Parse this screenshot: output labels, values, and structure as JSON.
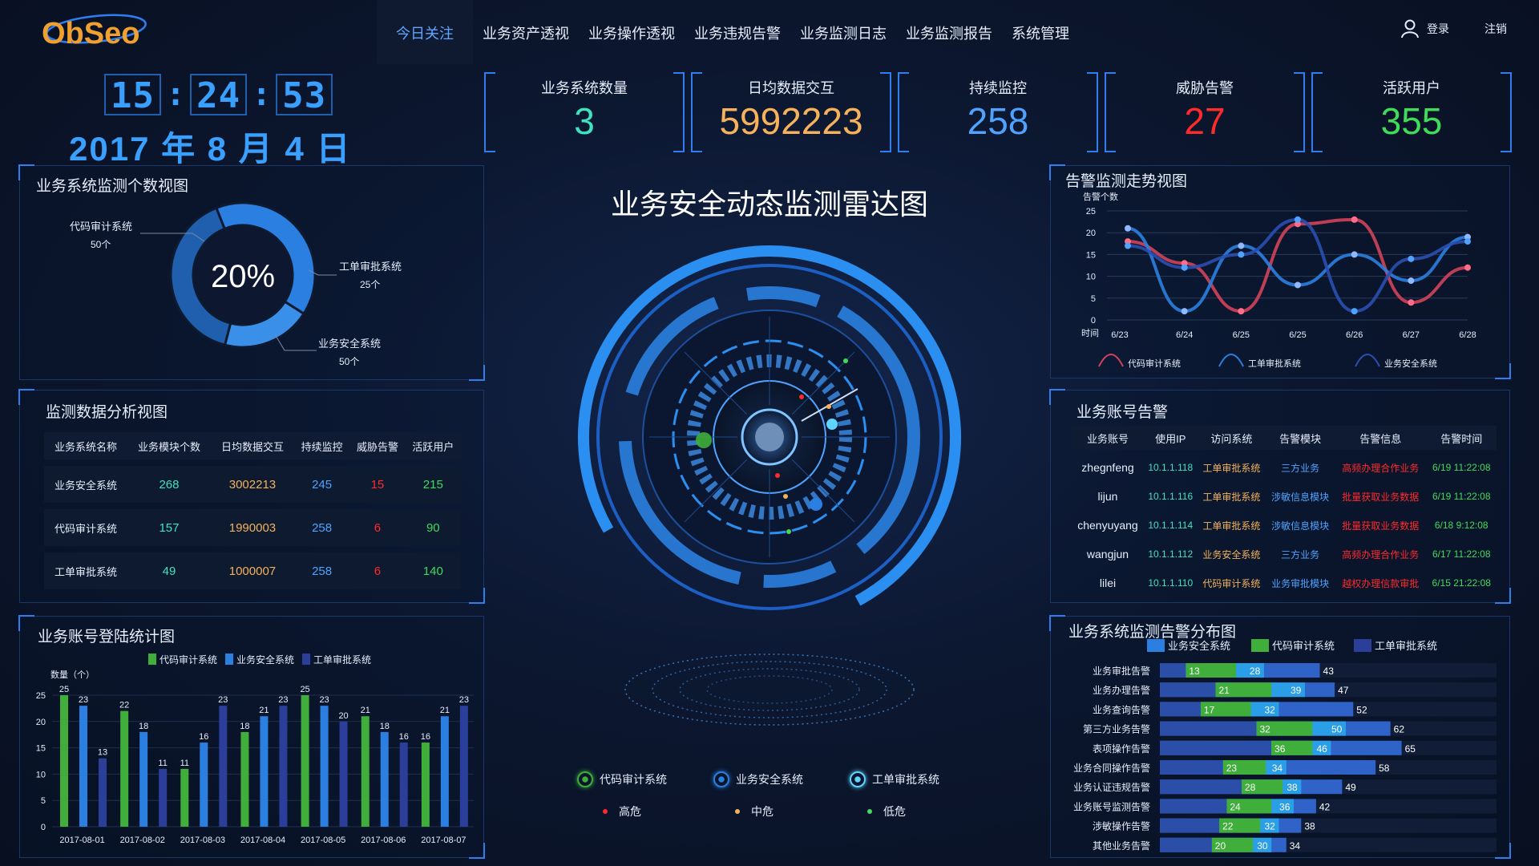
{
  "header": {
    "logo_text": "ObSeo",
    "nav": [
      {
        "label": "今日关注",
        "active": true
      },
      {
        "label": "业务资产透视",
        "active": false
      },
      {
        "label": "业务操作透视",
        "active": false
      },
      {
        "label": "业务违规告警",
        "active": false
      },
      {
        "label": "业务监测日志",
        "active": false
      },
      {
        "label": "业务监测报告",
        "active": false
      },
      {
        "label": "系统管理",
        "active": false
      }
    ],
    "login": "登录",
    "logout": "注销",
    "user_icon": "user-icon"
  },
  "clock": {
    "h": "15",
    "m": "24",
    "s": "53"
  },
  "date": "2017 年  8 月 4 日",
  "kpis": [
    {
      "label": "业务系统数量",
      "value": "3",
      "color": "#3fe3c0"
    },
    {
      "label": "日均数据交互",
      "value": "5992223",
      "color": "#f5b25a"
    },
    {
      "label": "持续监控",
      "value": "258",
      "color": "#4fa3ff"
    },
    {
      "label": "威胁告警",
      "value": "27",
      "color": "#ff2a2a"
    },
    {
      "label": "活跃用户",
      "value": "355",
      "color": "#3fdc5a"
    }
  ],
  "donut": {
    "title": "业务系统监测个数视图",
    "center": "20%",
    "labels": [
      {
        "name": "代码审计系统",
        "value": "50个"
      },
      {
        "name": "工单审批系统",
        "value": "25个"
      },
      {
        "name": "业务安全系统",
        "value": "50个"
      }
    ],
    "chart_data": {
      "type": "pie",
      "categories": [
        "代码审计系统",
        "工单审批系统",
        "业务安全系统"
      ],
      "values": [
        50,
        25,
        50
      ]
    }
  },
  "monitor": {
    "title": "监测数据分析视图",
    "headers": [
      "业务系统名称",
      "业务模块个数",
      "日均数据交互",
      "持续监控",
      "威胁告警",
      "活跃用户"
    ],
    "rows": [
      [
        "业务安全系统",
        "268",
        "3002213",
        "245",
        "15",
        "215"
      ],
      [
        "代码审计系统",
        "157",
        "1990003",
        "258",
        "6",
        "90"
      ],
      [
        "工单审批系统",
        "49",
        "1000007",
        "258",
        "6",
        "140"
      ]
    ],
    "colors": [
      "#e6eefc",
      "#3fe3c0",
      "#f5b25a",
      "#4fa3ff",
      "#ff2a2a",
      "#3fdc5a"
    ]
  },
  "login_chart": {
    "title": "业务账号登陆统计图",
    "ylabel": "数量（个）",
    "legend": [
      "代码审计系统",
      "业务安全系统",
      "工单审批系统"
    ],
    "colors": [
      "#3fae3a",
      "#2a7fe0",
      "#2b3f9a"
    ],
    "chart_data": {
      "type": "bar",
      "categories": [
        "2017-08-01",
        "2017-08-02",
        "2017-08-03",
        "2017-08-04",
        "2017-08-05",
        "2017-08-06",
        "2017-08-07"
      ],
      "series": [
        {
          "name": "代码审计系统",
          "values": [
            25,
            22,
            11,
            18,
            25,
            21,
            16
          ]
        },
        {
          "name": "业务安全系统",
          "values": [
            23,
            18,
            16,
            21,
            23,
            18,
            21
          ]
        },
        {
          "name": "工单审批系统",
          "values": [
            13,
            11,
            23,
            23,
            20,
            16,
            23
          ]
        }
      ],
      "ylim": [
        0,
        25
      ],
      "yticks": [
        0,
        5,
        10,
        15,
        20,
        25
      ]
    }
  },
  "radar": {
    "title": "业务安全动态监测雷达图",
    "legend": [
      {
        "label": "代码审计系统",
        "color": "#3fae3a"
      },
      {
        "label": "业务安全系统",
        "color": "#2a7fe0"
      },
      {
        "label": "工单审批系统",
        "color": "#5fd4ff"
      }
    ],
    "levels": [
      {
        "label": "高危",
        "color": "#ff2a2a"
      },
      {
        "label": "中危",
        "color": "#f5b25a"
      },
      {
        "label": "低危",
        "color": "#3fdc5a"
      }
    ]
  },
  "trend": {
    "title": "告警监测走势视图",
    "ylabel": "告警个数",
    "xlabel": "时间",
    "legend": [
      "代码审计系统",
      "工单审批系统",
      "业务安全系统"
    ],
    "chart_data": {
      "type": "line",
      "x": [
        "6/23",
        "6/24",
        "6/25",
        "6/25",
        "6/26",
        "6/27",
        "6/28"
      ],
      "series": [
        {
          "name": "代码审计系统",
          "values": [
            18,
            13,
            2,
            22,
            23,
            4,
            12
          ]
        },
        {
          "name": "工单审批系统",
          "values": [
            21,
            2,
            17,
            8,
            15,
            9,
            19
          ]
        },
        {
          "name": "业务安全系统",
          "values": [
            17,
            12,
            15,
            23,
            2,
            14,
            18
          ]
        }
      ],
      "ylim": [
        0,
        25
      ],
      "yticks": [
        0,
        5,
        10,
        15,
        20,
        25
      ]
    }
  },
  "account_alerts": {
    "title": "业务账号告警",
    "headers": [
      "业务账号",
      "使用IP",
      "访问系统",
      "告警模块",
      "告警信息",
      "告警时间"
    ],
    "rows": [
      [
        "zhegnfeng",
        "10.1.1.118",
        "工单审批系统",
        "三方业务",
        "高频办理合作业务",
        "6/19 11:22:08"
      ],
      [
        "lijun",
        "10.1.1.116",
        "工单审批系统",
        "涉敏信息模块",
        "批量获取业务数据",
        "6/19 11:22:08"
      ],
      [
        "chenyuyang",
        "10.1.1.114",
        "工单审批系统",
        "涉敏信息模块",
        "批量获取业务数据",
        "6/18 9:12:08"
      ],
      [
        "wangjun",
        "10.1.1.112",
        "业务安全系统",
        "三方业务",
        "高频办理合作业务",
        "6/17 11:22:08"
      ],
      [
        "lilei",
        "10.1.1.110",
        "代码审计系统",
        "业务审批模块",
        "越权办理信款审批",
        "6/15 21:22:08"
      ]
    ]
  },
  "dist": {
    "title": "业务系统监测告警分布图",
    "legend": [
      "业务安全系统",
      "代码审计系统",
      "工单审批系统"
    ],
    "colors": [
      "#2a7fe0",
      "#3fae3a",
      "#2b3f9a"
    ],
    "chart_data": {
      "type": "bar",
      "orientation": "horizontal",
      "stacked": true,
      "categories": [
        "业务审批告警",
        "业务办理告警",
        "业务查询告警",
        "第三方业务告警",
        "表项操作告警",
        "业务合同操作告警",
        "业务认证违规告警",
        "业务账号监测告警",
        "涉敏操作告警",
        "其他业务告警"
      ],
      "series": [
        {
          "name": "业务安全系统",
          "values": [
            13,
            21,
            17,
            32,
            36,
            23,
            28,
            24,
            22,
            20
          ]
        },
        {
          "name": "代码审计系统",
          "values": [
            28,
            39,
            32,
            50,
            46,
            34,
            38,
            36,
            32,
            30
          ]
        },
        {
          "name": "工单审批系统",
          "values": [
            43,
            47,
            52,
            62,
            65,
            58,
            49,
            42,
            38,
            34
          ]
        }
      ]
    }
  }
}
